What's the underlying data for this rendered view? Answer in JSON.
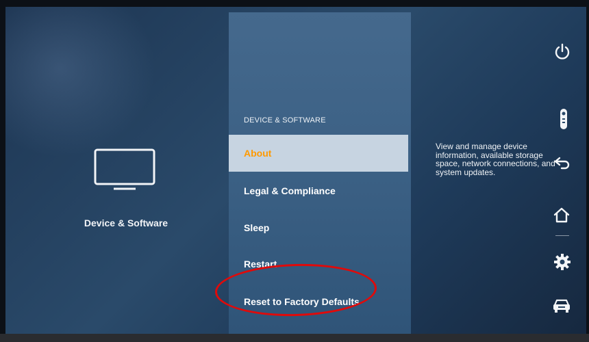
{
  "left": {
    "icon": "tv-icon",
    "title": "Device & Software"
  },
  "menu": {
    "heading": "DEVICE & SOFTWARE",
    "items": [
      {
        "label": "About",
        "active": true
      },
      {
        "label": "Legal & Compliance",
        "active": false
      },
      {
        "label": "Sleep",
        "active": false
      },
      {
        "label": "Restart",
        "active": false
      },
      {
        "label": "Reset to Factory Defaults",
        "active": false
      }
    ]
  },
  "description": "View and manage device information, available storage space, network connections, and system updates.",
  "side_icons": [
    "power-icon",
    "remote-icon",
    "back-icon",
    "home-icon",
    "settings-icon",
    "car-icon"
  ],
  "colors": {
    "active_text": "#ff9a00",
    "active_bg": "#c7d4e1",
    "annotation": "#e00a0a"
  }
}
